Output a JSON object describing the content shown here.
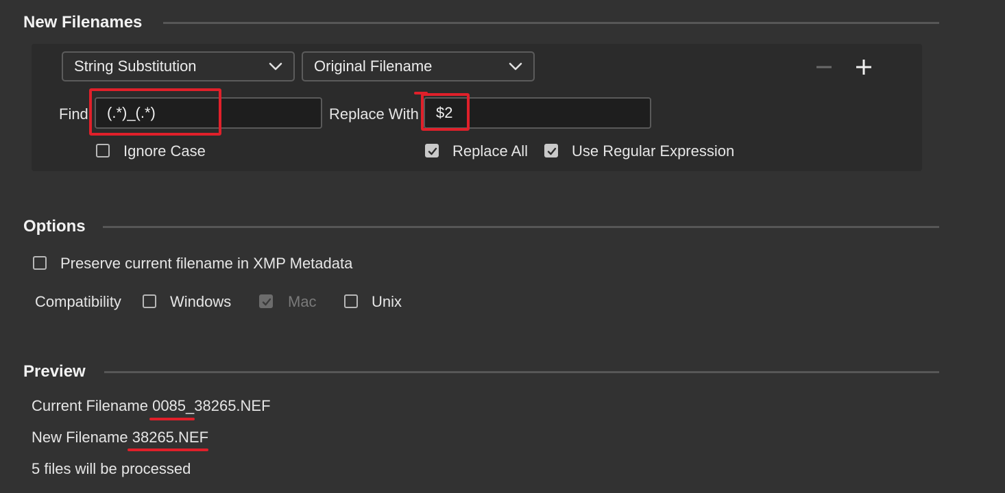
{
  "sections": {
    "new_filenames": "New Filenames",
    "options": "Options",
    "preview": "Preview"
  },
  "rule": {
    "method_select": "String Substitution",
    "source_select": "Original Filename",
    "remove_symbol": "−",
    "add_symbol": "+",
    "find_label": "Find",
    "find_value": "(.*)_(.*)",
    "replace_label": "Replace With",
    "replace_value": "$2",
    "ignore_case_label": "Ignore Case",
    "ignore_case_checked": false,
    "replace_all_label": "Replace All",
    "replace_all_checked": true,
    "use_regex_label": "Use Regular Expression",
    "use_regex_checked": true
  },
  "options": {
    "preserve_label": "Preserve current filename in XMP Metadata",
    "preserve_checked": false,
    "compatibility_label": "Compatibility",
    "windows_label": "Windows",
    "windows_checked": false,
    "mac_label": "Mac",
    "mac_checked": true,
    "unix_label": "Unix",
    "unix_checked": false
  },
  "preview": {
    "current_label": "Current Filename",
    "current_value": "0085_38265.NEF",
    "new_label": "New Filename",
    "new_value": "38265.NEF",
    "count_text": "5 files will be processed"
  },
  "colors": {
    "background": "#323232",
    "panel": "#2b2b2b",
    "annotation_red": "#e0202a"
  },
  "icons": [
    "chevron-down-icon",
    "minus-icon",
    "plus-icon",
    "checkmark-icon"
  ]
}
